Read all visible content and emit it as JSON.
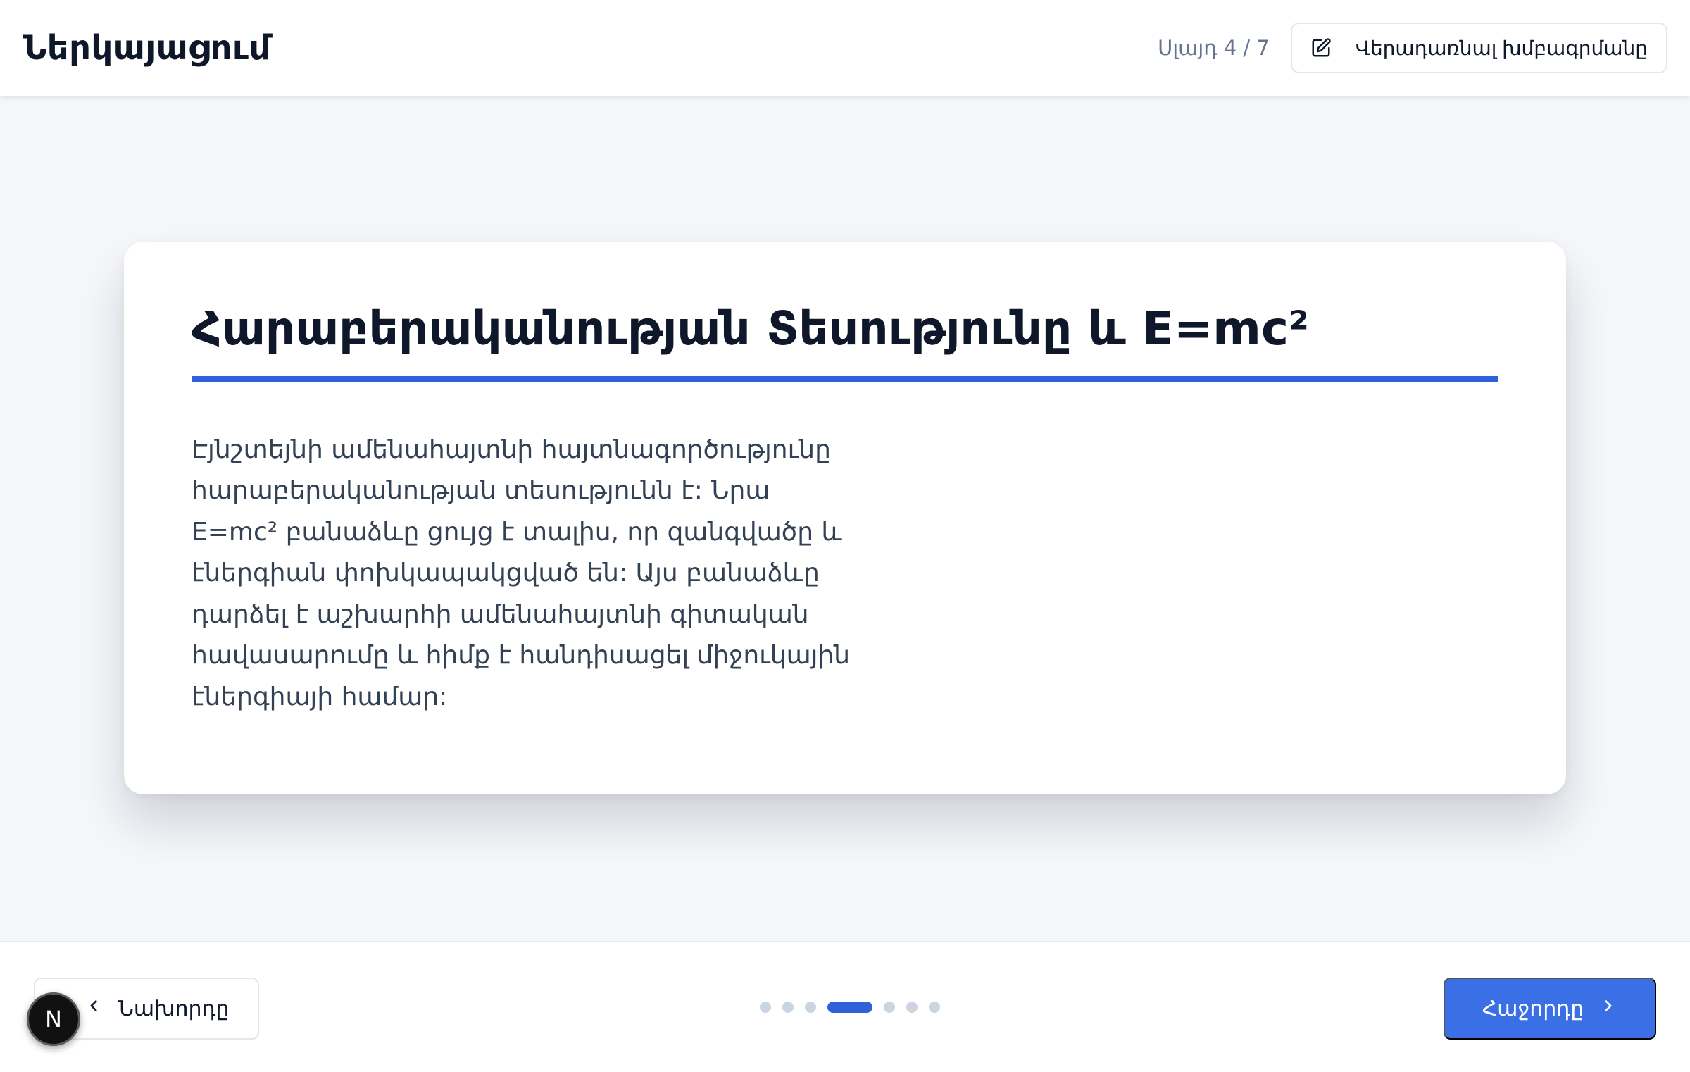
{
  "header": {
    "title": "Ներկայացում",
    "page_indicator": "Սլայդ 4 / 7",
    "edit_button_label": "Վերադառնալ խմբագրմանը",
    "edit_icon": "edit-icon"
  },
  "slide": {
    "title": "Հարաբերականության Տեսությունը և E=mc²",
    "body": "Էյնշտեյնի ամենահայտնի հայտնագործությունը հարաբերականության տեսությունն է: Նրա E=mc² բանաձևը ցույց է տալիս, որ զանգվածը և էներգիան փոխկապակցված են: Այս բանաձևը դարձել է աշխարհի ամենահայտնի գիտական հավասարումը և հիմք է հանդիսացել միջուկային էներգիայի համար:"
  },
  "footer": {
    "prev_label": "Նախորդը",
    "next_label": "Հաջորդը",
    "total_slides": 7,
    "current_slide": 4,
    "accent_color": "#2f62d8",
    "next_button_color": "#3b6fe6",
    "prev_icon": "chevron-left-icon",
    "next_icon": "chevron-right-icon"
  },
  "badge": {
    "letter": "N"
  }
}
